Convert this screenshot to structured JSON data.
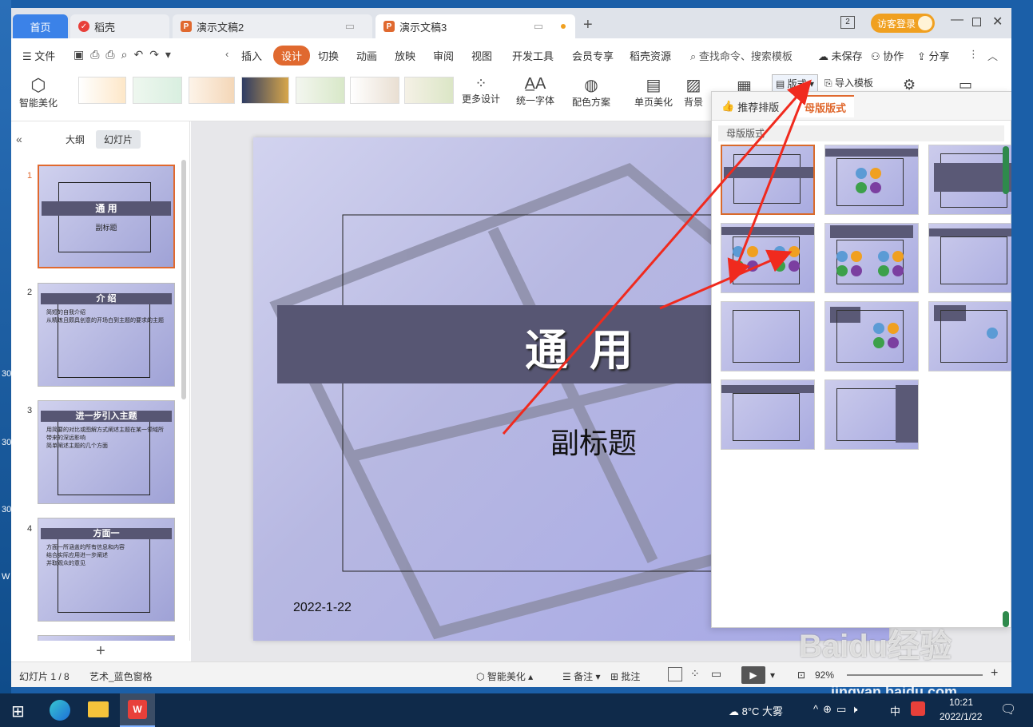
{
  "desktop": {
    "side_labels": [
      "30",
      "30",
      "30",
      "W"
    ]
  },
  "tabs": [
    {
      "label": "首页"
    },
    {
      "label": "稻壳"
    },
    {
      "label": "演示文稿2"
    },
    {
      "label": "演示文稿3"
    }
  ],
  "titlebar": {
    "badge": "2",
    "login": "访客登录"
  },
  "menu": {
    "file": "文件",
    "items": [
      "插入",
      "设计",
      "切换",
      "动画",
      "放映",
      "审阅",
      "视图",
      "开发工具",
      "会员专享",
      "稻壳资源"
    ],
    "active": "设计",
    "search_placeholder": "查找命令、搜索模板",
    "unsaved": "未保存",
    "collab": "协作",
    "share": "分享"
  },
  "ribbon": {
    "smart_beautify": "智能美化",
    "more_design": "更多设计",
    "unify_font": "统一字体",
    "color_scheme": "配色方案",
    "single_page": "单页美化",
    "background": "背景",
    "layout_btn": "版式",
    "import_template": "导入模板"
  },
  "leftpane": {
    "tab_outline": "大纲",
    "tab_slides": "幻灯片",
    "slides": [
      {
        "num": "1",
        "title": "通 用",
        "sub": "副标题",
        "bullets": []
      },
      {
        "num": "2",
        "title": "介 绍",
        "bullets": [
          "简短的自我介绍",
          "从精炼且颇具创意的开场白到主题的要求的主题"
        ]
      },
      {
        "num": "3",
        "title": "进一步引入主题",
        "bullets": [
          "用简要的对比或图解方式阐述主题在某一领域所带来的深远影响",
          "简单阐述主题的几个方面"
        ]
      },
      {
        "num": "4",
        "title": "方面一",
        "bullets": [
          "方面一所涵盖的所有信息和内容",
          "结合实际应用进一步阐述",
          "并取观众的意见"
        ]
      }
    ]
  },
  "slide": {
    "title": "通  用",
    "subtitle": "副标题",
    "date": "2022-1-22"
  },
  "panel": {
    "tab_recommend": "推荐排版",
    "tab_master": "母版版式",
    "section": "母版版式"
  },
  "status": {
    "slide_count": "幻灯片 1 / 8",
    "theme": "艺术_蓝色窗格",
    "smart": "智能美化",
    "notes": "备注",
    "comment": "批注",
    "zoom": "92%"
  },
  "taskbar": {
    "weather": "8°C 大雾",
    "ime": "中",
    "time": "10:21",
    "date": "2022/1/22"
  },
  "watermark": {
    "line1": "Baidu经验",
    "line2": "jingyan.baidu.com"
  },
  "colors": {
    "accent": "#e0692f",
    "brand": "#3b82e8",
    "slide_bar": "#575673",
    "arrow": "#f02a1e"
  }
}
